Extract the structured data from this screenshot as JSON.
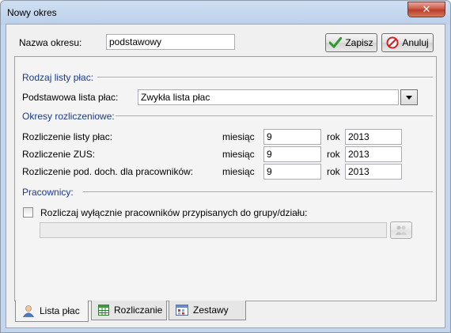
{
  "window": {
    "title": "Nowy okres",
    "close_glyph": "✕"
  },
  "header": {
    "name_label": "Nazwa okresu:",
    "name_value": "podstawowy",
    "save_label": "Zapisz",
    "cancel_label": "Anuluj"
  },
  "sections": {
    "payroll_type": "Rodzaj listy płac:",
    "settlement_periods": "Okresy rozliczeniowe:",
    "employees": "Pracownicy:"
  },
  "payroll": {
    "label": "Podstawowa lista płac:",
    "value": "Zwykła lista płac"
  },
  "periods": [
    {
      "label": "Rozliczenie listy płac:",
      "month_label": "miesiąc",
      "month": "9",
      "year_label": "rok",
      "year": "2013"
    },
    {
      "label": "Rozliczenie ZUS:",
      "month_label": "miesiąc",
      "month": "9",
      "year_label": "rok",
      "year": "2013"
    },
    {
      "label": "Rozliczenie pod. doch. dla pracowników:",
      "month_label": "miesiąc",
      "month": "9",
      "year_label": "rok",
      "year": "2013"
    }
  ],
  "employees": {
    "checkbox_label": "Rozliczaj wyłącznie pracowników przypisanych do grupy/działu:",
    "checked": false,
    "group_value": ""
  },
  "tabs": [
    {
      "label": "Lista płac",
      "icon": "person-icon",
      "active": true
    },
    {
      "label": "Rozliczanie",
      "icon": "spreadsheet-icon",
      "active": false
    },
    {
      "label": "Zestawy",
      "icon": "calendar-icon",
      "active": false
    }
  ],
  "colors": {
    "section_title": "#1a3a8a",
    "save_check": "#2e9a2e",
    "cancel_red": "#d02020"
  }
}
